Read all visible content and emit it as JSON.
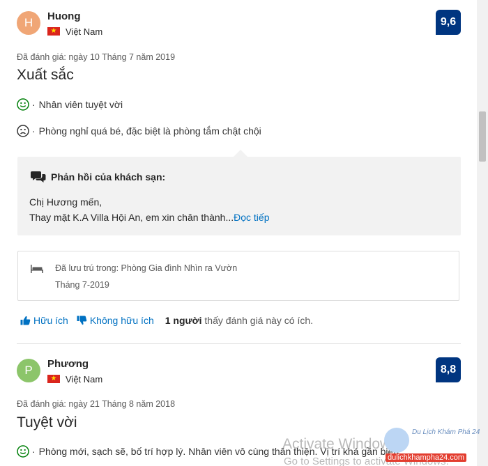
{
  "reviews": [
    {
      "avatar_initial": "H",
      "name": "Huong",
      "country": "Việt Nam",
      "score": "9,6",
      "date": "Đã đánh giá: ngày 10 Tháng 7 năm 2019",
      "title": "Xuất sắc",
      "positive": "Nhân viên tuyệt vời",
      "negative": "Phòng nghỉ quá bé, đặc biệt là phòng tắm chật chội",
      "reply": {
        "heading": "Phản hồi của khách sạn:",
        "line1": "Chị Hương mến,",
        "line2": "Thay mặt K.A Villa Hội An, em xin chân thành...",
        "read_more": "Đọc tiếp"
      },
      "stay": {
        "label": "Đã lưu trú trong:",
        "room": "Phòng Gia đình Nhìn ra Vườn",
        "date": "Tháng 7-2019"
      },
      "helpful": {
        "yes_label": "Hữu ích",
        "no_label": "Không hữu ích",
        "count": "1 người",
        "text": "thấy đánh giá này có ích."
      }
    },
    {
      "avatar_initial": "P",
      "name": "Phương",
      "country": "Việt Nam",
      "score": "8,8",
      "date": "Đã đánh giá: ngày 21 Tháng 8 năm 2018",
      "title": "Tuyệt vời",
      "positive": "Phòng mới, sạch sẽ, bố trí hợp lý. Nhân viên vô cùng thân thiện. Vị trí khá gần biển"
    }
  ],
  "comment_separator": "·",
  "overlay": {
    "activate_title": "Activate Windows",
    "activate_sub": "Go to Settings to activate Windows.",
    "watermark_title": "Du Lịch Khám Phá 24",
    "watermark_url": "dulichkhampha24.com"
  },
  "colors": {
    "score_badge": "#003580",
    "link": "#0071c2",
    "avatar_h": "#f0a676",
    "avatar_p": "#8cc56a",
    "positive_face": "#008009",
    "reply_bg": "#f2f2f2"
  }
}
